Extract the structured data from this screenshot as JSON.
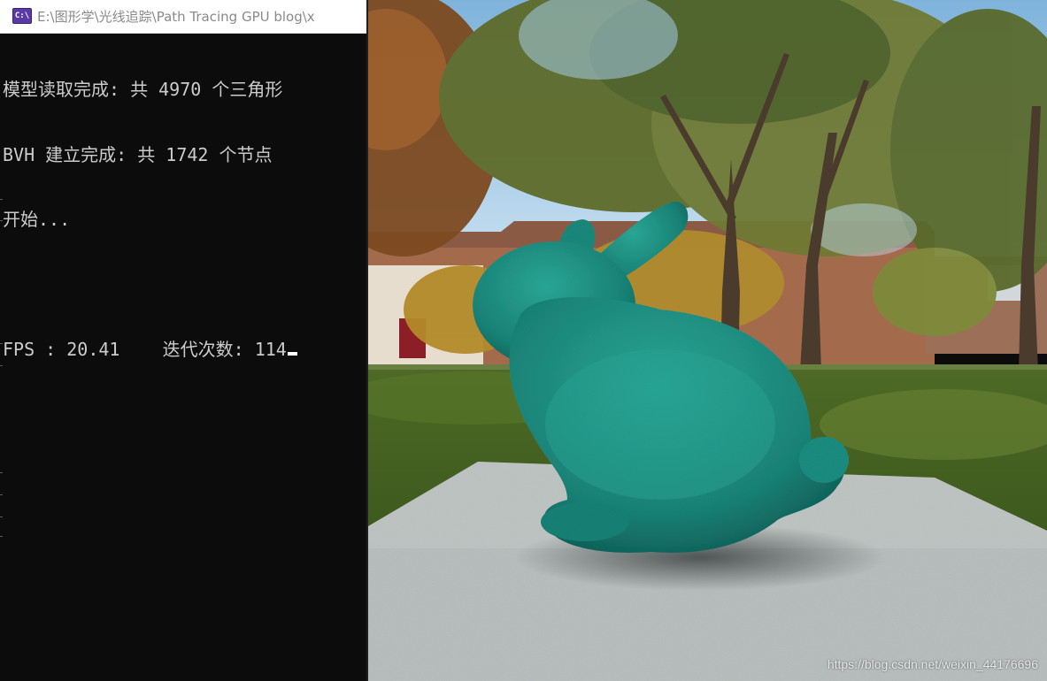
{
  "console": {
    "title": "E:\\图形学\\光线追踪\\Path Tracing GPU blog\\x",
    "icon": "console-app-icon",
    "icon_text": "C:\\",
    "lines": [
      "模型读取完成: 共 4970 个三角形",
      "BVH 建立完成: 共 1742 个节点",
      "开始...",
      "",
      "FPS : 20.41    迭代次数: 114"
    ]
  },
  "render": {
    "scene": "stanford-bunny-on-plane-outdoor-park",
    "colors": {
      "bunny": "#1f9488",
      "plane": "#b9bfbe",
      "sky": "#a6cde8",
      "grass": "#3f5c1f"
    }
  },
  "watermark": "https://blog.csdn.net/weixin_44176696"
}
